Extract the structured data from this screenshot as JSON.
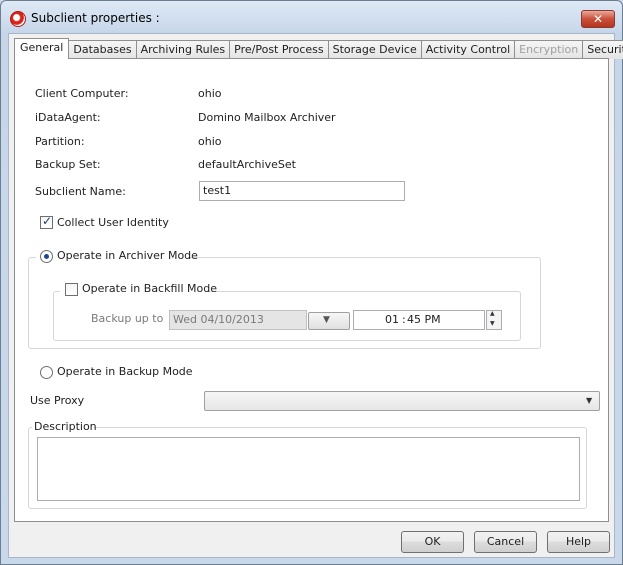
{
  "window": {
    "title": "Subclient properties :",
    "close_glyph": "✕"
  },
  "tabs": [
    {
      "label": "General",
      "active": true
    },
    {
      "label": "Databases"
    },
    {
      "label": "Archiving Rules"
    },
    {
      "label": "Pre/Post Process"
    },
    {
      "label": "Storage Device"
    },
    {
      "label": "Activity Control"
    },
    {
      "label": "Encryption",
      "disabled": true
    },
    {
      "label": "Security"
    }
  ],
  "general": {
    "client_computer_label": "Client Computer:",
    "client_computer_value": "ohio",
    "idataagent_label": "iDataAgent:",
    "idataagent_value": "Domino Mailbox Archiver",
    "partition_label": "Partition:",
    "partition_value": "ohio",
    "backup_set_label": "Backup Set:",
    "backup_set_value": "defaultArchiveSet",
    "subclient_name_label": "Subclient Name:",
    "subclient_name_value": "test1",
    "collect_user_identity_label": "Collect User Identity",
    "collect_user_identity_checked": true,
    "archiver_mode_label": "Operate in Archiver Mode",
    "archiver_mode_selected": true,
    "backfill_mode_label": "Operate in Backfill Mode",
    "backfill_mode_checked": false,
    "backup_up_to_label": "Backup up to",
    "backup_date_value": "Wed 04/10/2013",
    "backup_time_hour": "01",
    "backup_time_sep": ":",
    "backup_time_minute": "45 PM",
    "backup_mode_label": "Operate in Backup Mode",
    "backup_mode_selected": false,
    "use_proxy_label": "Use Proxy",
    "use_proxy_value": "",
    "description_label": "Description",
    "description_value": ""
  },
  "buttons": {
    "ok": "OK",
    "cancel": "Cancel",
    "help": "Help"
  },
  "icons": {
    "dropdown": "▼",
    "spin_up": "▲",
    "spin_down": "▼",
    "check": "✓"
  }
}
